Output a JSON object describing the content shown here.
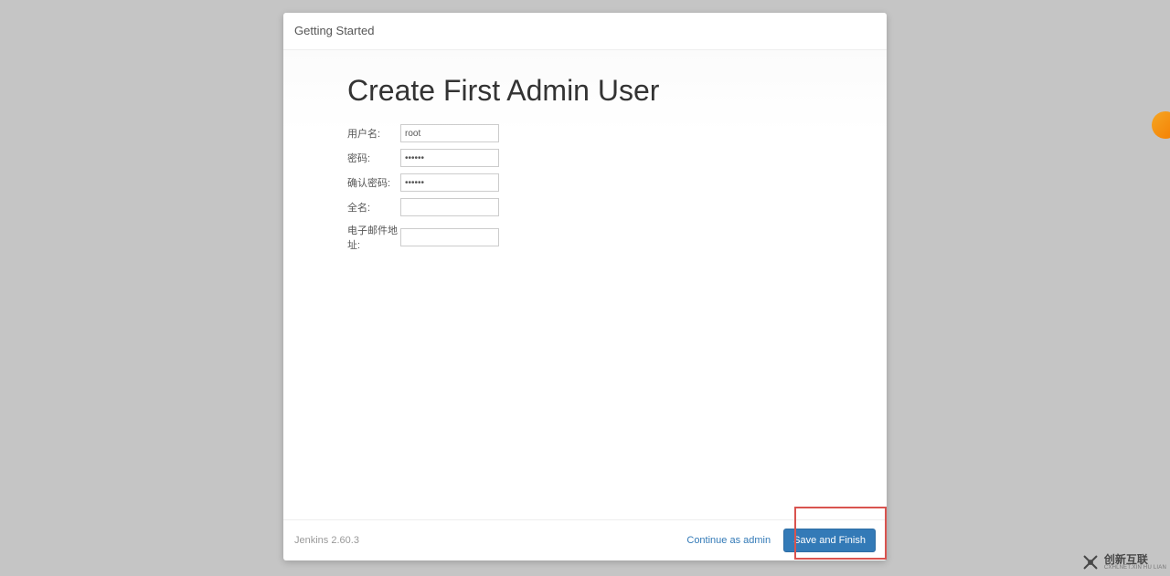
{
  "header": {
    "title": "Getting Started"
  },
  "main": {
    "heading": "Create First Admin User",
    "form": {
      "username_label": "用户名:",
      "username_value": "root",
      "password_label": "密码:",
      "password_value": "••••••",
      "confirm_label": "确认密码:",
      "confirm_value": "••••••",
      "fullname_label": "全名:",
      "fullname_value": "",
      "email_label": "电子邮件地址:",
      "email_value": ""
    }
  },
  "footer": {
    "version": "Jenkins 2.60.3",
    "continue_label": "Continue as admin",
    "save_label": "Save and Finish"
  },
  "watermark": {
    "cn": "创新互联",
    "en": "CXHLNET.XIN HU LIAN"
  }
}
